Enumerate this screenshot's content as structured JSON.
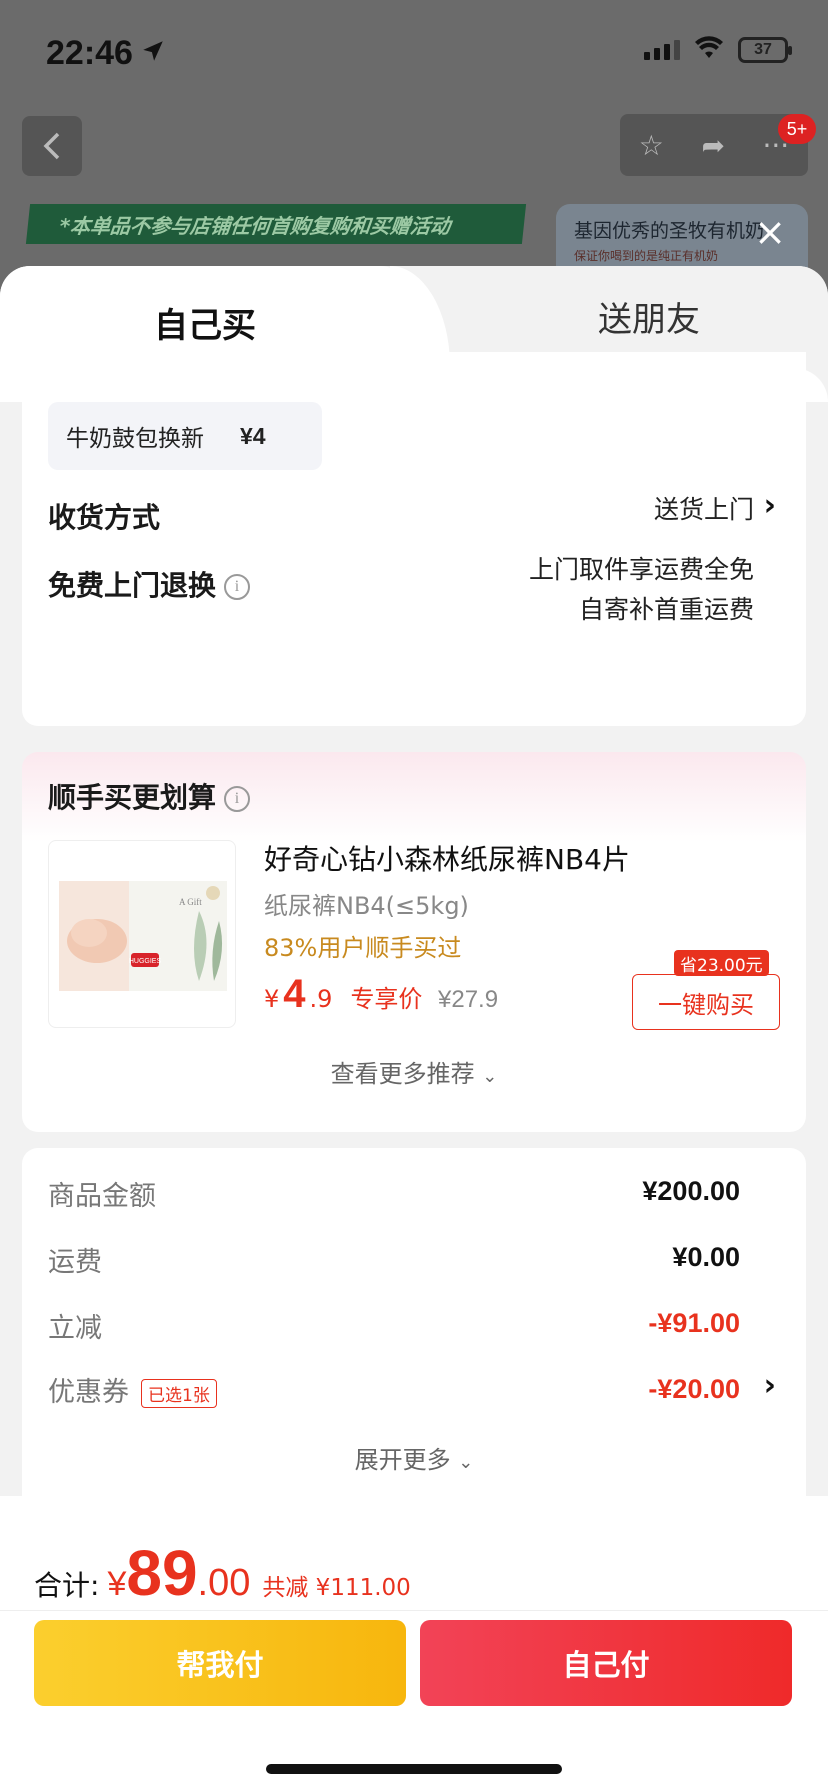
{
  "status_bar": {
    "time": "22:46",
    "battery": "37"
  },
  "bg": {
    "badge": "5+",
    "banner_text": "*本单品不参与店铺任何首购复购和买赠活动",
    "promo_title": "基因优秀的圣牧有机奶",
    "promo_sub": "保证你喝到的是纯正有机奶"
  },
  "tabs": {
    "self": "自己买",
    "friend": "送朋友"
  },
  "options": {
    "chip_name": "牛奶鼓包换新",
    "chip_price": "¥4",
    "delivery_label": "收货方式",
    "delivery_value": "送货上门",
    "return_label": "免费上门退换",
    "return_line1": "上门取件享运费全免",
    "return_line2": "自寄补首重运费"
  },
  "reco": {
    "title": "顺手买更划算",
    "product_name": "好奇心钻小森林纸尿裤NB4片",
    "spec": "纸尿裤NB4(≤5kg)",
    "stat": "83%用户顺手买过",
    "price_cur": "¥",
    "price_int": "4",
    "price_dec": ".9",
    "price_tag": "专享价",
    "orig_price": "¥27.9",
    "save_badge": "省23.00元",
    "buy_label": "一键购买",
    "more_label": "查看更多推荐",
    "img_brand": "HUGGIES",
    "img_caption": "A Gift"
  },
  "summary": {
    "rows": [
      {
        "label": "商品金额",
        "value": "¥200.00"
      },
      {
        "label": "运费",
        "value": "¥0.00"
      },
      {
        "label": "立减",
        "value": "-¥91.00"
      },
      {
        "label": "优惠券",
        "value": "-¥20.00",
        "tag": "已选1张"
      }
    ],
    "expand_label": "展开更多"
  },
  "footer": {
    "total_label": "合计:",
    "currency": "¥",
    "total_int": "89",
    "total_dec": ".00",
    "discount": "共减 ¥111.00",
    "btn_help": "帮我付",
    "btn_self": "自己付"
  },
  "colors": {
    "accent_red": "#e8321e",
    "yellow": "#fbcf2e",
    "stat_orange": "#c88a1f"
  }
}
